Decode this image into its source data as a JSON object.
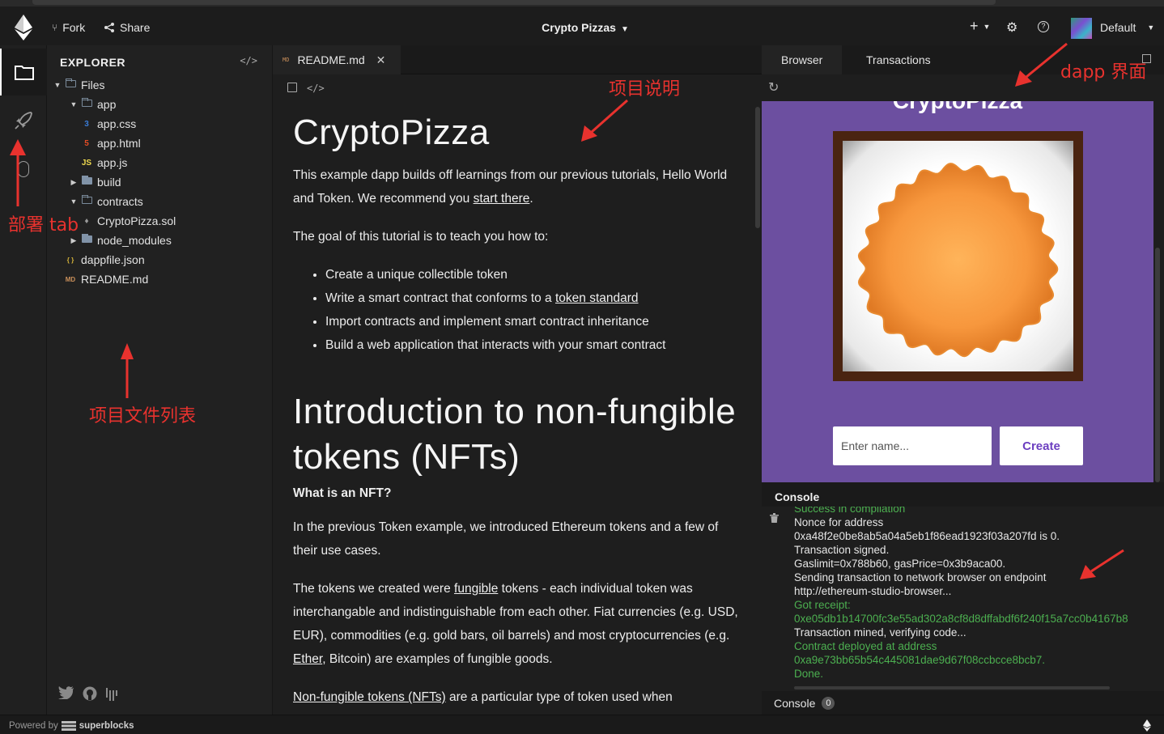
{
  "topbar": {
    "fork_label": "Fork",
    "share_label": "Share",
    "project_title": "Crypto Pizzas",
    "add_label": "+",
    "account_label": "Default"
  },
  "explorer": {
    "title": "EXPLORER",
    "tree": [
      {
        "label": "Files",
        "kind": "folder-open"
      },
      {
        "label": "app",
        "kind": "folder-open"
      },
      {
        "label": "app.css",
        "kind": "css"
      },
      {
        "label": "app.html",
        "kind": "html"
      },
      {
        "label": "app.js",
        "kind": "js"
      },
      {
        "label": "build",
        "kind": "folder"
      },
      {
        "label": "contracts",
        "kind": "folder-open"
      },
      {
        "label": "CryptoPizza.sol",
        "kind": "sol"
      },
      {
        "label": "node_modules",
        "kind": "folder"
      },
      {
        "label": "dappfile.json",
        "kind": "json"
      },
      {
        "label": "README.md",
        "kind": "md"
      }
    ],
    "icon_glyphs": {
      "css": "3",
      "html": "5",
      "js": "JS",
      "sol": "♦",
      "json": "{ }",
      "md": "MD"
    }
  },
  "editor": {
    "tab_label": "README.md",
    "doc": {
      "h1": "CryptoPizza",
      "p1_text": "This example dapp builds off learnings from our previous tutorials, Hello World and Token. We recommend you ",
      "p1_link": "start there",
      "p1_end": ".",
      "p2": "The goal of this tutorial is to teach you how to:",
      "li1": "Create a unique collectible token",
      "li2_text": "Write a smart contract that conforms to a ",
      "li2_link": "token standard",
      "li3": "Import contracts and implement smart contract inheritance",
      "li4": "Build a web application that interacts with your smart contract",
      "h1b": "Introduction to non-fungible tokens (NFTs)",
      "h2": "What is an NFT?",
      "p3": "In the previous Token example, we introduced Ethereum tokens and a few of their use cases.",
      "p4_a": "The tokens we created were ",
      "p4_link1": "fungible",
      "p4_b": " tokens - each individual token was interchangable and indistinguishable from each other. Fiat currencies (e.g. USD, EUR), commodities (e.g. gold bars, oil barrels) and most cryptocurrencies (e.g. ",
      "p4_link2": "Ether",
      "p4_c": ", Bitcoin) are examples of fungible goods.",
      "p5_link": "Non-fungible tokens (NFTs)",
      "p5_rest": " are a particular type of token used when"
    }
  },
  "right": {
    "tab_browser": "Browser",
    "tab_transactions": "Transactions",
    "dapp_title": "CryptoPizza",
    "name_placeholder": "Enter name...",
    "create_label": "Create",
    "console_title": "Console",
    "console_lines": [
      {
        "text": "Success in compilation",
        "ok": true
      },
      {
        "text": "Nonce for address",
        "ok": false
      },
      {
        "text": "0xa48f2e0be8ab5a04a5eb1f86ead1923f03a207fd is 0.",
        "ok": false
      },
      {
        "text": "Transaction signed.",
        "ok": false
      },
      {
        "text": "Gaslimit=0x788b60, gasPrice=0x3b9aca00.",
        "ok": false
      },
      {
        "text": "Sending transaction to network browser on endpoint",
        "ok": false
      },
      {
        "text": "http://ethereum-studio-browser...",
        "ok": false
      },
      {
        "text": "Got receipt:",
        "ok": true
      },
      {
        "text": "0xe05db1b14700fc3e55ad302a8cf8d8dffabdf6f240f15a7cc0b4167b8",
        "ok": true
      },
      {
        "text": "Transaction mined, verifying code...",
        "ok": false
      },
      {
        "text": "Contract deployed at address",
        "ok": true
      },
      {
        "text": "0xa9e73bb65b54c445081dae9d67f08ccbcce8bcb7.",
        "ok": true
      },
      {
        "text": "Done.",
        "ok": true
      }
    ],
    "footer_label": "Console",
    "footer_count": "0"
  },
  "statusbar": {
    "powered_by": "Powered by",
    "brand": "superblocks"
  },
  "annotations": {
    "deploy_tab": "部署 tab",
    "file_list": "项目文件列表",
    "readme": "项目说明",
    "dapp_ui": "dapp 界面"
  },
  "colors": {
    "accent_purple": "#6c4fa0",
    "create_text": "#6c3fc0",
    "console_ok": "#4caf50",
    "annotation_red": "#e8322e",
    "pizza_orange": "#f5913a"
  }
}
